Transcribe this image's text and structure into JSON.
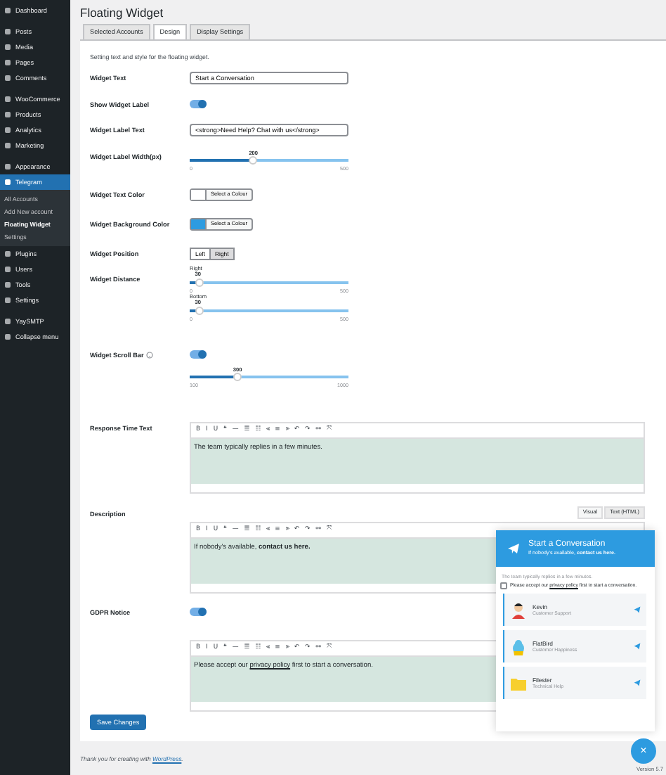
{
  "sidebar": {
    "groups": [
      [
        {
          "label": "Dashboard",
          "selected": false
        }
      ],
      [
        {
          "label": "Posts",
          "selected": false
        },
        {
          "label": "Media",
          "selected": false
        },
        {
          "label": "Pages",
          "selected": false
        },
        {
          "label": "Comments",
          "selected": false
        }
      ],
      [
        {
          "label": "WooCommerce",
          "selected": false
        },
        {
          "label": "Products",
          "selected": false
        },
        {
          "label": "Analytics",
          "selected": false
        },
        {
          "label": "Marketing",
          "selected": false
        }
      ],
      [
        {
          "label": "Appearance",
          "selected": false
        },
        {
          "label": "Telegram",
          "selected": true,
          "children": [
            {
              "label": "All Accounts",
              "selected": false
            },
            {
              "label": "Add New account",
              "selected": false
            },
            {
              "label": "Floating Widget",
              "selected": true
            },
            {
              "label": "Settings",
              "selected": false
            }
          ]
        },
        {
          "label": "Plugins",
          "selected": false
        },
        {
          "label": "Users",
          "selected": false
        },
        {
          "label": "Tools",
          "selected": false
        },
        {
          "label": "Settings",
          "selected": false
        }
      ],
      [
        {
          "label": "YaySMTP",
          "selected": false
        },
        {
          "label": "Collapse menu",
          "selected": false
        }
      ]
    ]
  },
  "page_title": "Floating Widget",
  "tabs": [
    {
      "label": "Selected Accounts",
      "selected": false
    },
    {
      "label": "Design",
      "selected": true
    },
    {
      "label": "Display Settings",
      "selected": false
    }
  ],
  "intro": "Setting text and style for the floating widget.",
  "fields": [
    {
      "kind": "text",
      "label": "Widget Text",
      "value": "Start a Conversation"
    },
    {
      "kind": "toggle",
      "label": "Show Widget Label",
      "on": true
    },
    {
      "kind": "text",
      "label": "Widget Label Text",
      "value": "<strong>Need Help? Chat with us</strong>"
    },
    {
      "kind": "slider",
      "label": "Widget Label Width(px)",
      "sliders": [
        {
          "reading": "200",
          "min": "0",
          "max": "500",
          "level": 0.4
        }
      ]
    },
    {
      "kind": "color",
      "label": "Widget Text Color",
      "button": "Select a Colour",
      "color": "#ffffff"
    },
    {
      "kind": "color",
      "label": "Widget Background Color",
      "button": "Select a Colour",
      "color": "#2d9be0"
    },
    {
      "kind": "segmented",
      "label": "Widget Position",
      "options": [
        {
          "label": "Left",
          "selected": false
        },
        {
          "label": "Right",
          "selected": true
        }
      ]
    },
    {
      "kind": "slider",
      "label": "Widget Distance",
      "sliders": [
        {
          "caption": "Right",
          "reading": "30",
          "min": "0",
          "max": "500",
          "level": 0.06
        },
        {
          "caption": "Bottom",
          "reading": "30",
          "min": "0",
          "max": "500",
          "level": 0.06
        }
      ]
    },
    {
      "kind": "toggle",
      "label": "Widget Scroll Bar",
      "help_icon": true,
      "on": true,
      "sliders": [
        {
          "reading": "300",
          "min": "100",
          "max": "1000",
          "level": 0.3
        }
      ]
    },
    {
      "kind": "editor",
      "label": "Response Time Text",
      "toolbar": [
        "B",
        "I",
        "U",
        "❝",
        "—",
        "☰",
        "☷",
        "⫷",
        "≡",
        "⫸",
        "↶",
        "↷",
        "⚯",
        "⤧"
      ],
      "text": "The team typically replies in a few minutes."
    },
    {
      "kind": "editor",
      "label": "Description",
      "modes": [
        {
          "label": "Visual",
          "selected": false
        },
        {
          "label": "Text (HTML)",
          "selected": true
        }
      ],
      "toolbar": [
        "B",
        "I",
        "U",
        "❝",
        "—",
        "☰",
        "☷",
        "⫷",
        "≡",
        "⫸",
        "↶",
        "↷",
        "⚯",
        "⤧"
      ],
      "text": "If nobody's available, **contact us here.**"
    },
    {
      "kind": "toggle",
      "label": "GDPR Notice",
      "on": true
    },
    {
      "kind": "editor",
      "toolbar": [
        "B",
        "I",
        "U",
        "❝",
        "—",
        "☰",
        "☷",
        "⫷",
        "≡",
        "⫸",
        "↶",
        "↷",
        "⚯",
        "⤧"
      ],
      "text_before": "Please accept our ",
      "link": "privacy policy",
      "text_after": " first to start a conversation."
    }
  ],
  "save_button": "Save Changes",
  "footer": {
    "text": "Thank you for creating with ",
    "link": "WordPress",
    "suffix": ".",
    "version": "Version 5.7"
  },
  "widget": {
    "title": "Start a Conversation",
    "subtitle": "If nobody's available, **contact us here.**",
    "response": "The team typically replies in a few minutes.",
    "gdpr_checked": false,
    "gdpr_before": "Please accept our ",
    "gdpr_link": "privacy policy",
    "gdpr_after": " first to start a conversation.",
    "agents": [
      {
        "name": "Kevin",
        "role": "Customer Support",
        "kind": "person"
      },
      {
        "name": "FlatBird",
        "role": "Customer Happiness",
        "kind": "bird"
      },
      {
        "name": "Filester",
        "role": "Technical Help",
        "kind": "folder"
      }
    ],
    "close": "×"
  }
}
